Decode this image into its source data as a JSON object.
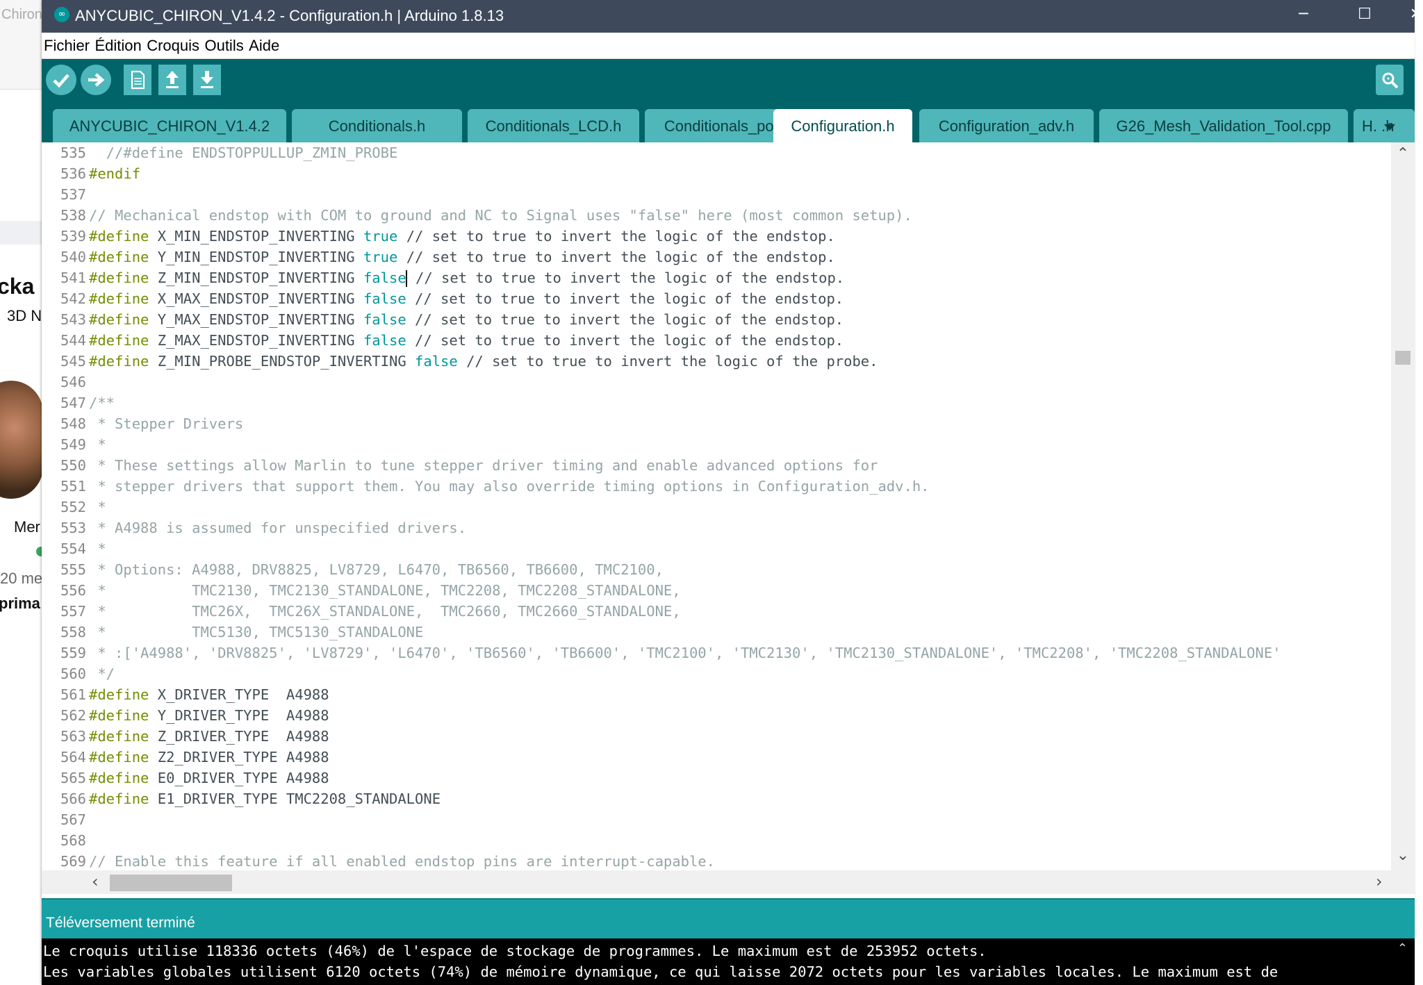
{
  "background_page": {
    "tab_title": "Chiron",
    "texts": [
      "cka",
      "3D N",
      "Mer",
      "20 me",
      "prima"
    ]
  },
  "window": {
    "title": "ANYCUBIC_CHIRON_V1.4.2 - Configuration.h | Arduino 1.8.13",
    "app_icon": "∞",
    "controls": {
      "minimize": "─",
      "maximize": "☐",
      "close": "✕"
    }
  },
  "menu": [
    "Fichier",
    "Édition",
    "Croquis",
    "Outils",
    "Aide"
  ],
  "toolbar": {
    "buttons": [
      "verify-icon",
      "upload-icon",
      "new-sketch-icon",
      "open-icon",
      "save-icon"
    ],
    "right": "serial-monitor-icon"
  },
  "tabs": [
    {
      "label": "ANYCUBIC_CHIRON_V1.4.2"
    },
    {
      "label": "Conditionals.h"
    },
    {
      "label": "Conditionals_LCD.h"
    },
    {
      "label": "Conditionals_post.h"
    },
    {
      "label": "Configuration.h",
      "active": true
    },
    {
      "label": "Configuration_adv.h"
    },
    {
      "label": "G26_Mesh_Validation_Tool.cpp"
    },
    {
      "label": "H. .h"
    }
  ],
  "editor": {
    "lines": [
      {
        "n": "535",
        "t": "  //#define ENDSTOPPULLUP_ZMIN_PROBE"
      },
      {
        "n": "536",
        "t": "#endif"
      },
      {
        "n": "537",
        "t": ""
      },
      {
        "n": "538",
        "t": "// Mechanical endstop with COM to ground and NC to Signal uses \"false\" here (most common setup)."
      },
      {
        "n": "539",
        "t": "#define X_MIN_ENDSTOP_INVERTING true // set to true to invert the logic of the endstop."
      },
      {
        "n": "540",
        "t": "#define Y_MIN_ENDSTOP_INVERTING true // set to true to invert the logic of the endstop."
      },
      {
        "n": "541",
        "t": "#define Z_MIN_ENDSTOP_INVERTING false // set to true to invert the logic of the endstop."
      },
      {
        "n": "542",
        "t": "#define X_MAX_ENDSTOP_INVERTING false // set to true to invert the logic of the endstop."
      },
      {
        "n": "543",
        "t": "#define Y_MAX_ENDSTOP_INVERTING false // set to true to invert the logic of the endstop."
      },
      {
        "n": "544",
        "t": "#define Z_MAX_ENDSTOP_INVERTING false // set to true to invert the logic of the endstop."
      },
      {
        "n": "545",
        "t": "#define Z_MIN_PROBE_ENDSTOP_INVERTING false // set to true to invert the logic of the probe."
      },
      {
        "n": "546",
        "t": ""
      },
      {
        "n": "547",
        "t": "/**"
      },
      {
        "n": "548",
        "t": " * Stepper Drivers"
      },
      {
        "n": "549",
        "t": " *"
      },
      {
        "n": "550",
        "t": " * These settings allow Marlin to tune stepper driver timing and enable advanced options for"
      },
      {
        "n": "551",
        "t": " * stepper drivers that support them. You may also override timing options in Configuration_adv.h."
      },
      {
        "n": "552",
        "t": " *"
      },
      {
        "n": "553",
        "t": " * A4988 is assumed for unspecified drivers."
      },
      {
        "n": "554",
        "t": " *"
      },
      {
        "n": "555",
        "t": " * Options: A4988, DRV8825, LV8729, L6470, TB6560, TB6600, TMC2100,"
      },
      {
        "n": "556",
        "t": " *          TMC2130, TMC2130_STANDALONE, TMC2208, TMC2208_STANDALONE,"
      },
      {
        "n": "557",
        "t": " *          TMC26X,  TMC26X_STANDALONE,  TMC2660, TMC2660_STANDALONE,"
      },
      {
        "n": "558",
        "t": " *          TMC5130, TMC5130_STANDALONE"
      },
      {
        "n": "559",
        "t": " * :['A4988', 'DRV8825', 'LV8729', 'L6470', 'TB6560', 'TB6600', 'TMC2100', 'TMC2130', 'TMC2130_STANDALONE', 'TMC2208', 'TMC2208_STANDALONE'"
      },
      {
        "n": "560",
        "t": " */"
      },
      {
        "n": "561",
        "t": "#define X_DRIVER_TYPE  A4988"
      },
      {
        "n": "562",
        "t": "#define Y_DRIVER_TYPE  A4988"
      },
      {
        "n": "563",
        "t": "#define Z_DRIVER_TYPE  A4988"
      },
      {
        "n": "564",
        "t": "#define Z2_DRIVER_TYPE A4988"
      },
      {
        "n": "565",
        "t": "#define E0_DRIVER_TYPE A4988"
      },
      {
        "n": "566",
        "t": "#define E1_DRIVER_TYPE TMC2208_STANDALONE"
      },
      {
        "n": "567",
        "t": ""
      },
      {
        "n": "568",
        "t": ""
      },
      {
        "n": "569",
        "t": "// Enable this feature if all enabled endstop pins are interrupt-capable."
      }
    ]
  },
  "status": "Téléversement terminé",
  "console": [
    "Le croquis utilise 118336 octets (46%) de l'espace de stockage de programmes. Le maximum est de 253952 octets.",
    "Les variables globales utilisent 6120 octets (74%) de mémoire dynamique, ce qui laisse 2072 octets pour les variables locales. Le maximum est de"
  ],
  "colors": {
    "titlebar": "#3e4a5c",
    "toolbar": "#006468",
    "tab": "#4fb6b9",
    "status": "#17a1a5",
    "keyword": "#728e00",
    "literal": "#00979c",
    "comment": "#95a5a6"
  }
}
